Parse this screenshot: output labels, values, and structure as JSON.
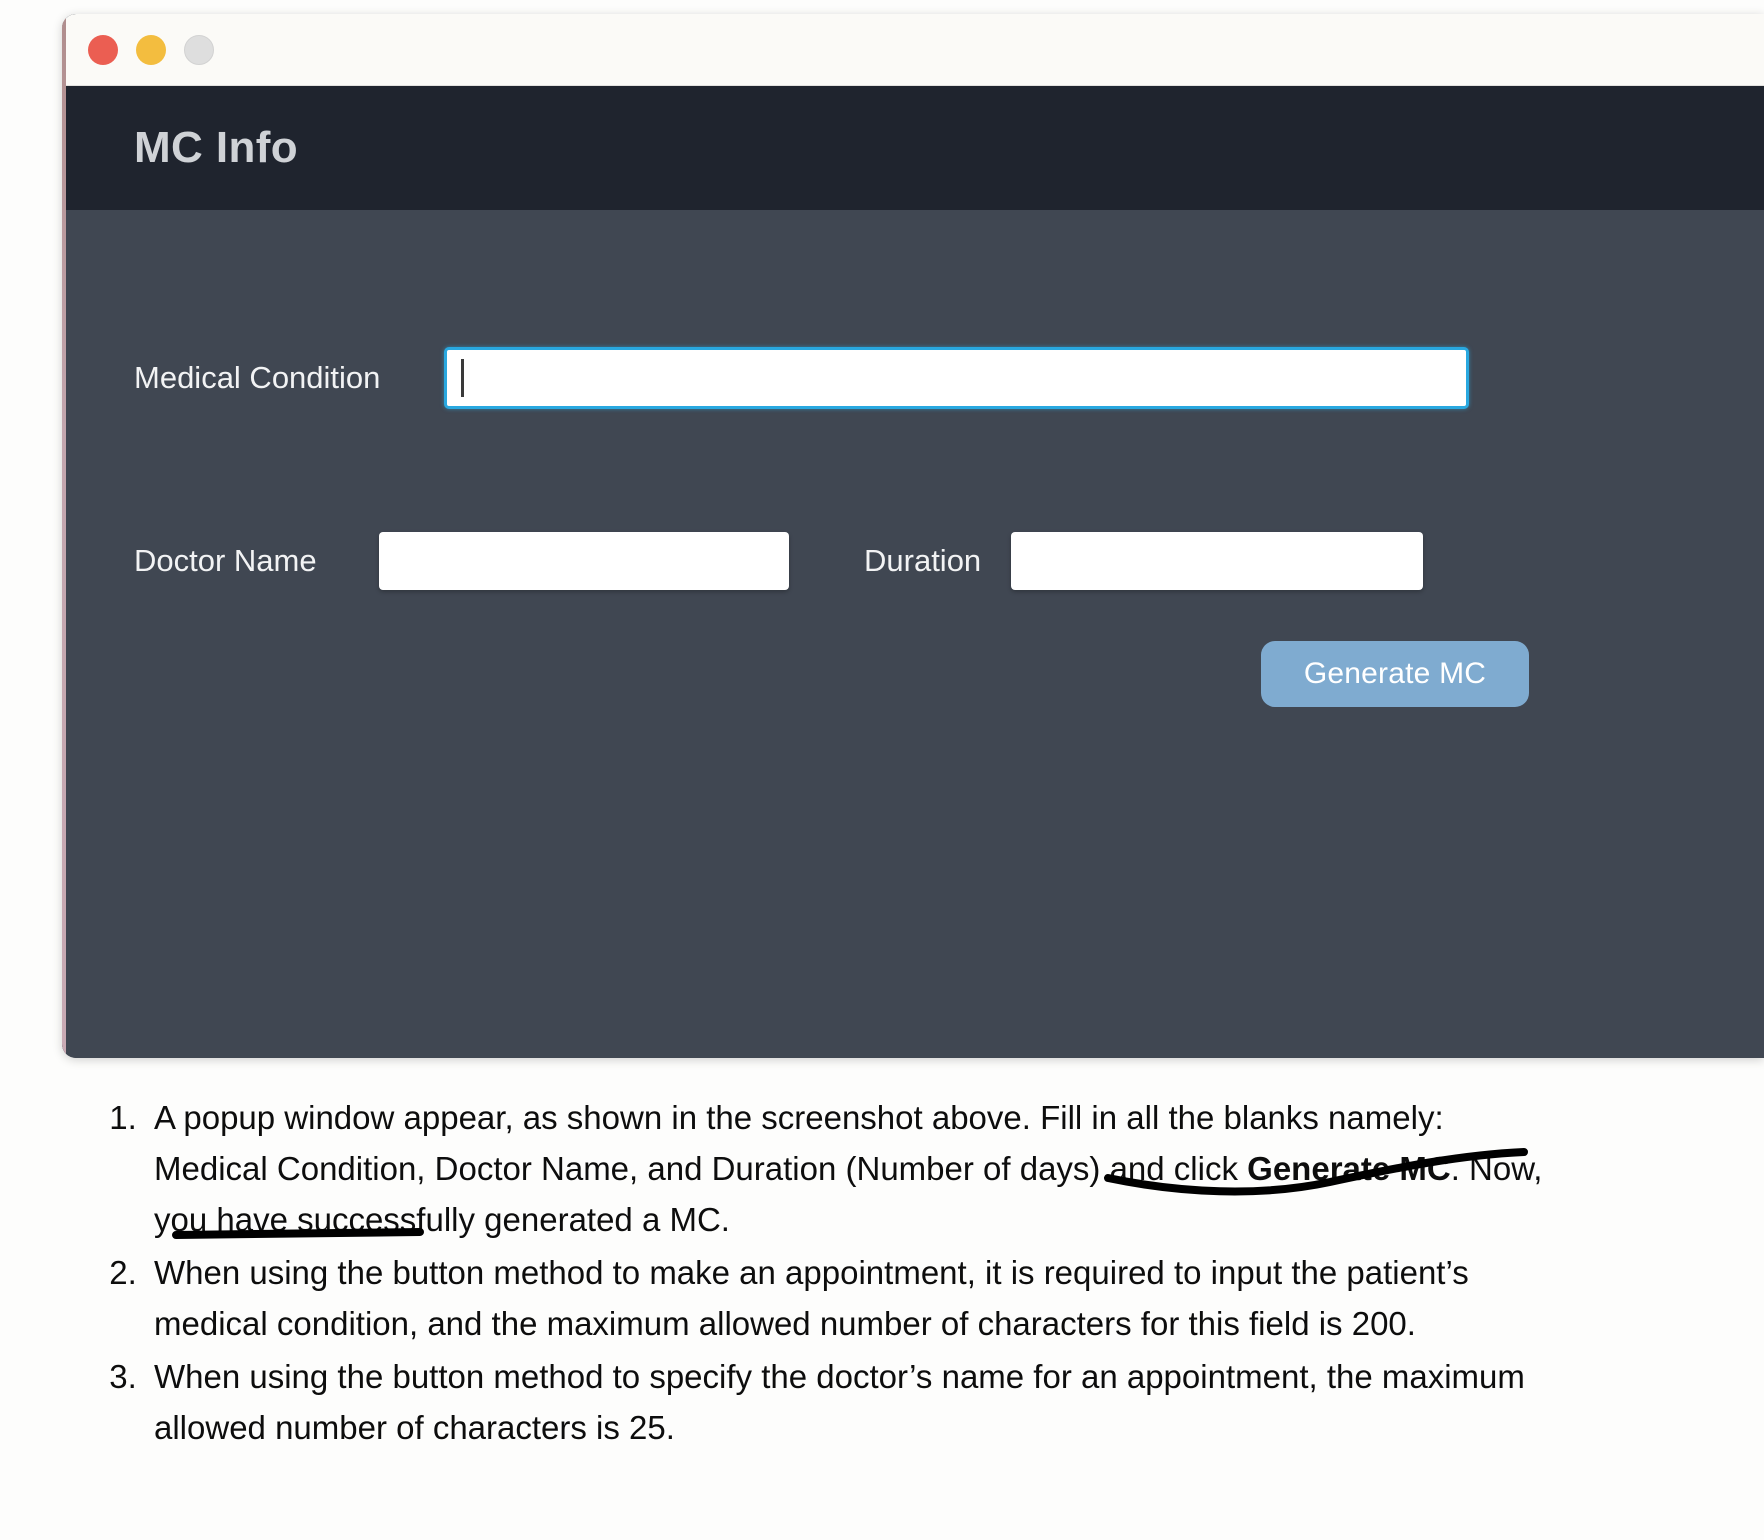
{
  "window": {
    "traffic_lights": [
      "close-red",
      "minimize-yellow",
      "zoom-grey"
    ],
    "app_title": "MC Info",
    "header_bg": "#1f242e",
    "body_bg": "#404752"
  },
  "form": {
    "medical_condition": {
      "label": "Medical Condition",
      "value": "",
      "placeholder": "",
      "focused": true,
      "focus_color": "#29a8e0"
    },
    "doctor_name": {
      "label": "Doctor Name",
      "value": "",
      "placeholder": ""
    },
    "duration": {
      "label": "Duration",
      "value": "",
      "placeholder": ""
    },
    "generate_button": {
      "label": "Generate MC",
      "color": "#7fabd0"
    }
  },
  "instructions": {
    "step1": {
      "part1": "A popup window appear, as shown in the screenshot above. Fill in all the blanks namely: Medical Condition, Doctor Name, and Duration (Number of days) and click ",
      "bold": "Generate MC",
      "part2": ". Now, you have successfully generated a MC."
    },
    "step2": {
      "text": "When using the button method to make an appointment, it is required to input the patient’s medical condition, and the maximum allowed number of characters for this field is 200."
    },
    "step3": {
      "text": "When using the button method to specify the doctor’s name for an appointment, the maximum allowed number of characters is 25."
    }
  }
}
